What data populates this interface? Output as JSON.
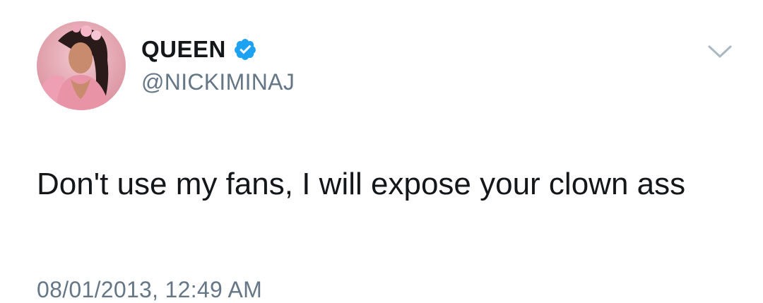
{
  "tweet": {
    "display_name": "QUEEN",
    "handle": "@NICKIMINAJ",
    "text": "Don't use my fans, I will expose your clown ass",
    "timestamp": "08/01/2013, 12:49 AM",
    "verified": true
  },
  "icons": {
    "verified": "verified-badge-icon",
    "menu": "chevron-down-icon"
  },
  "colors": {
    "verified_badge": "#1da1f2",
    "secondary_text": "#657786",
    "primary_text": "#14171a",
    "chevron": "#aab8c2"
  }
}
